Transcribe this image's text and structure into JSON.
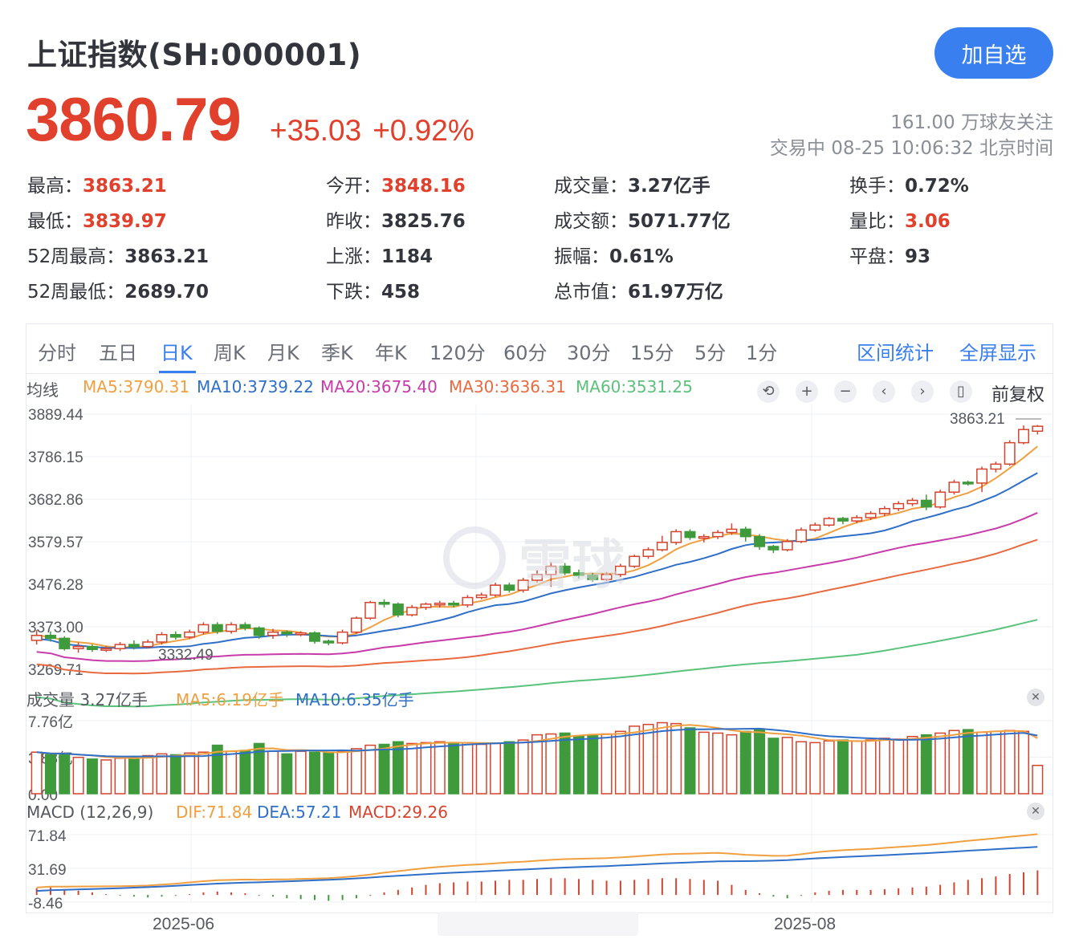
{
  "header": {
    "title": "上证指数(SH:000001)",
    "follow_button": "加自选",
    "price": "3860.79",
    "change": "+35.03",
    "change_pct": "+0.92%",
    "followers": "161.00 万球友关注",
    "trade_status": "交易中 08-25 10:06:32 北京时间"
  },
  "stats": [
    {
      "label": "最高：",
      "value": "3863.21",
      "red": true
    },
    {
      "label": "今开：",
      "value": "3848.16",
      "red": true
    },
    {
      "label": "成交量：",
      "value": "3.27亿手",
      "red": false
    },
    {
      "label": "换手：",
      "value": "0.72%",
      "red": false
    },
    {
      "label": "最低：",
      "value": "3839.97",
      "red": true
    },
    {
      "label": "昨收：",
      "value": "3825.76",
      "red": false
    },
    {
      "label": "成交额：",
      "value": "5071.77亿",
      "red": false
    },
    {
      "label": "量比：",
      "value": "3.06",
      "red": true
    },
    {
      "label": "52周最高：",
      "value": "3863.21",
      "red": false
    },
    {
      "label": "上涨：",
      "value": "1184",
      "red": false
    },
    {
      "label": "振幅：",
      "value": "0.61%",
      "red": false
    },
    {
      "label": "平盘：",
      "value": "93",
      "red": false
    },
    {
      "label": "52周最低：",
      "value": "2689.70",
      "red": false
    },
    {
      "label": "下跌：",
      "value": "458",
      "red": false
    },
    {
      "label": "总市值：",
      "value": "61.97万亿",
      "red": false
    }
  ],
  "tabs": [
    "分时",
    "五日",
    "日K",
    "周K",
    "月K",
    "季K",
    "年K",
    "120分",
    "60分",
    "30分",
    "15分",
    "5分",
    "1分"
  ],
  "active_tab": "日K",
  "tab_actions": [
    "区间统计",
    "全屏显示"
  ],
  "ma_legend": {
    "label": "均线",
    "items": [
      {
        "text": "MA5:3790.31",
        "color": "#f0a040"
      },
      {
        "text": "MA10:3739.22",
        "color": "#2f6fc8"
      },
      {
        "text": "MA20:3675.40",
        "color": "#c83caa"
      },
      {
        "text": "MA30:3636.31",
        "color": "#e86a40"
      },
      {
        "text": "MA60:3531.25",
        "color": "#5bc27c"
      }
    ]
  },
  "controls": [
    "undo-icon",
    "zoom-in-icon",
    "zoom-out-icon",
    "prev-icon",
    "next-icon",
    "candle-icon"
  ],
  "adjust_label": "前复权",
  "watermark": "雪球",
  "volume_legend": {
    "label": "成交量 3.27亿手",
    "ma5": "MA5:6.19亿手",
    "ma10": "MA10:6.35亿手"
  },
  "macd_legend": {
    "label": "MACD (12,26,9)",
    "dif": "DIF:71.84",
    "dea": "DEA:57.21",
    "macd": "MACD:29.26"
  },
  "date_labels": [
    "2025-06",
    "2025-08"
  ],
  "colors": {
    "up": "#d4442e",
    "down": "#3f9a3c",
    "accent": "#3a7ff0"
  },
  "chart_data": [
    {
      "type": "candlestick",
      "y_ticks": [
        "3889.44",
        "3786.15",
        "3682.86",
        "3579.57",
        "3476.28",
        "3373.00",
        "3269.71"
      ],
      "ylim": [
        3269.71,
        3889.44
      ],
      "max_label": "3863.21",
      "min_label": "3332.49",
      "candles": [
        [
          3340,
          3352,
          3365,
          3330
        ],
        [
          3352,
          3345,
          3362,
          3337
        ],
        [
          3345,
          3320,
          3350,
          3315
        ],
        [
          3320,
          3325,
          3335,
          3310
        ],
        [
          3325,
          3318,
          3330,
          3312
        ],
        [
          3318,
          3320,
          3326,
          3312
        ],
        [
          3320,
          3330,
          3336,
          3314
        ],
        [
          3330,
          3325,
          3340,
          3318
        ],
        [
          3325,
          3336,
          3342,
          3320
        ],
        [
          3336,
          3354,
          3360,
          3330
        ],
        [
          3354,
          3348,
          3362,
          3342
        ],
        [
          3348,
          3360,
          3366,
          3344
        ],
        [
          3360,
          3378,
          3384,
          3354
        ],
        [
          3378,
          3362,
          3384,
          3356
        ],
        [
          3362,
          3378,
          3384,
          3356
        ],
        [
          3378,
          3370,
          3384,
          3364
        ],
        [
          3370,
          3352,
          3374,
          3344
        ],
        [
          3352,
          3360,
          3368,
          3344
        ],
        [
          3360,
          3356,
          3364,
          3348
        ],
        [
          3356,
          3358,
          3362,
          3350
        ],
        [
          3358,
          3338,
          3362,
          3332
        ],
        [
          3338,
          3334,
          3342,
          3328
        ],
        [
          3334,
          3360,
          3366,
          3330
        ],
        [
          3360,
          3394,
          3398,
          3356
        ],
        [
          3394,
          3432,
          3436,
          3390
        ],
        [
          3432,
          3428,
          3440,
          3420
        ],
        [
          3428,
          3402,
          3432,
          3396
        ],
        [
          3402,
          3420,
          3426,
          3398
        ],
        [
          3420,
          3428,
          3432,
          3414
        ],
        [
          3428,
          3430,
          3436,
          3420
        ],
        [
          3430,
          3426,
          3436,
          3420
        ],
        [
          3426,
          3444,
          3450,
          3420
        ],
        [
          3444,
          3450,
          3456,
          3440
        ],
        [
          3450,
          3474,
          3480,
          3446
        ],
        [
          3474,
          3462,
          3480,
          3456
        ],
        [
          3462,
          3486,
          3492,
          3456
        ],
        [
          3486,
          3500,
          3510,
          3480
        ],
        [
          3500,
          3520,
          3530,
          3470
        ],
        [
          3520,
          3504,
          3528,
          3498
        ],
        [
          3504,
          3498,
          3512,
          3490
        ],
        [
          3498,
          3488,
          3504,
          3482
        ],
        [
          3488,
          3500,
          3506,
          3484
        ],
        [
          3500,
          3520,
          3526,
          3494
        ],
        [
          3520,
          3544,
          3548,
          3516
        ],
        [
          3544,
          3560,
          3566,
          3538
        ],
        [
          3560,
          3578,
          3594,
          3556
        ],
        [
          3578,
          3604,
          3610,
          3572
        ],
        [
          3604,
          3590,
          3610,
          3584
        ],
        [
          3590,
          3592,
          3598,
          3578
        ],
        [
          3592,
          3602,
          3608,
          3586
        ],
        [
          3602,
          3610,
          3624,
          3596
        ],
        [
          3610,
          3592,
          3616,
          3580
        ],
        [
          3592,
          3568,
          3598,
          3560
        ],
        [
          3568,
          3560,
          3572,
          3552
        ],
        [
          3560,
          3580,
          3586,
          3556
        ],
        [
          3580,
          3608,
          3614,
          3576
        ],
        [
          3608,
          3620,
          3626,
          3604
        ],
        [
          3620,
          3636,
          3640,
          3616
        ],
        [
          3636,
          3630,
          3640,
          3622
        ],
        [
          3630,
          3638,
          3644,
          3624
        ],
        [
          3638,
          3648,
          3654,
          3632
        ],
        [
          3648,
          3660,
          3666,
          3642
        ],
        [
          3660,
          3672,
          3678,
          3654
        ],
        [
          3672,
          3680,
          3686,
          3666
        ],
        [
          3680,
          3664,
          3694,
          3656
        ],
        [
          3664,
          3700,
          3706,
          3660
        ],
        [
          3700,
          3724,
          3730,
          3694
        ],
        [
          3724,
          3722,
          3728,
          3716
        ],
        [
          3722,
          3756,
          3762,
          3700
        ],
        [
          3756,
          3768,
          3774,
          3748
        ],
        [
          3768,
          3820,
          3826,
          3764
        ],
        [
          3820,
          3852,
          3862,
          3816
        ],
        [
          3848,
          3860,
          3863,
          3840
        ]
      ]
    },
    {
      "type": "bar",
      "title": "volume",
      "y_ticks": [
        "7.76亿",
        "3.88亿",
        "0.00"
      ],
      "ylim": [
        0,
        7.76
      ],
      "values": [
        4.8,
        4.5,
        4.6,
        4.2,
        4.0,
        3.9,
        4.1,
        4.3,
        4.4,
        4.6,
        4.5,
        4.7,
        4.8,
        5.6,
        4.9,
        5.0,
        5.8,
        4.9,
        4.6,
        4.9,
        4.8,
        4.7,
        4.9,
        5.2,
        5.6,
        5.7,
        6.0,
        5.8,
        5.9,
        6.0,
        5.8,
        5.9,
        5.7,
        5.8,
        6.0,
        6.2,
        6.8,
        6.9,
        7.0,
        6.7,
        6.8,
        6.9,
        7.2,
        7.8,
        8.0,
        8.2,
        8.1,
        7.6,
        7.1,
        7.0,
        6.8,
        7.2,
        7.4,
        6.4,
        6.5,
        6.0,
        5.9,
        6.1,
        6.2,
        6.1,
        6.2,
        6.4,
        6.3,
        6.6,
        6.8,
        7.0,
        7.3,
        7.4,
        7.1,
        7.2,
        7.3,
        7.2,
        3.27
      ],
      "colors": "from_candles"
    },
    {
      "type": "bar",
      "title": "MACD",
      "y_ticks": [
        "71.84",
        "31.69",
        "-8.46"
      ],
      "ylim": [
        -8.46,
        71.84
      ],
      "values": [
        8,
        9,
        7,
        5,
        3,
        1,
        -1,
        -2,
        -3,
        -2,
        -1,
        1,
        3,
        4,
        3,
        2,
        -1,
        -2,
        -4,
        -5,
        -6,
        -7,
        -6,
        -4,
        -1,
        3,
        6,
        9,
        12,
        14,
        15,
        16,
        16,
        17,
        18,
        18,
        19,
        20,
        20,
        19,
        18,
        17,
        17,
        18,
        19,
        20,
        20,
        19,
        18,
        17,
        12,
        6,
        2,
        -2,
        -4,
        -1,
        3,
        5,
        6,
        6,
        6,
        7,
        8,
        9,
        10,
        12,
        15,
        18,
        20,
        22,
        25,
        27,
        29.26
      ]
    }
  ]
}
